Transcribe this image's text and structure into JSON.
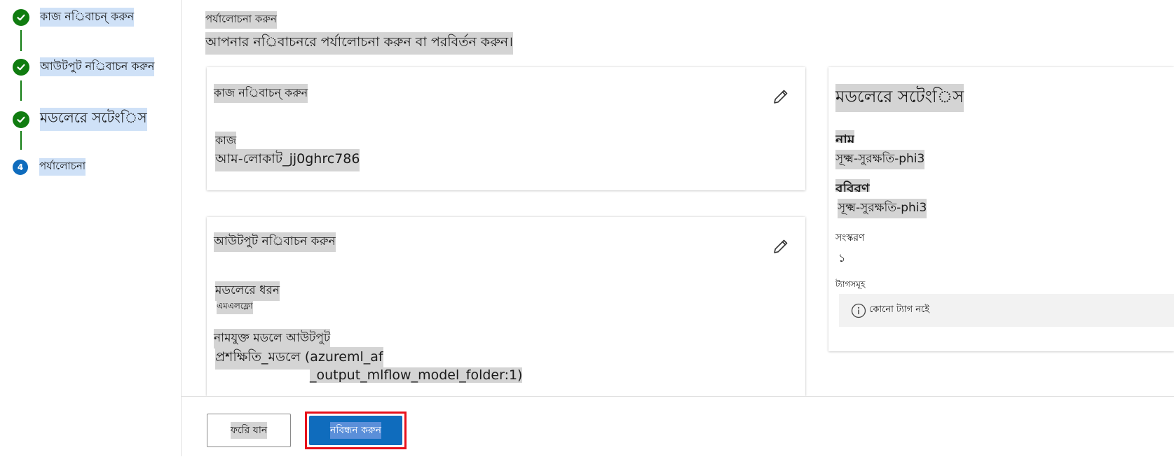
{
  "steps": [
    {
      "label": "কাজ নর্িবাচন্ করুন",
      "state": "done"
    },
    {
      "label": "আউটপুট নর্িবাচন করুন",
      "state": "done"
    },
    {
      "label": "মডলেরে সটেংিস",
      "state": "done"
    },
    {
      "label": "পর্যালোচনা",
      "state": "current",
      "number": "4"
    }
  ],
  "review": {
    "title": "পর্যালোচনা করুন",
    "subtitle": "আপনার নর্িবাচনরে পর্যালোচনা করুন বা পরবির্তন করুন।"
  },
  "task_card": {
    "title": "কাজ নর্িবাচন্ করুন",
    "field_label": "কাজ",
    "field_value": "আম-লোকাট_jj0ghrc786"
  },
  "output_card": {
    "title": "আউটপুট নর্িবাচন করুন",
    "model_type_label": "মডলেরে ধরন",
    "model_type_value": "এমএলফ্লো",
    "named_output_label": "নামযুক্ত মডলে আউটপুট",
    "named_output_value_line1": "প্রশক্ষিতি_মডলে (azureml_af",
    "named_output_value_line2": "_output_mlflow_model_folder:1)"
  },
  "settings_card": {
    "title": "মডলেরে সটেংিস",
    "name_label": "নাম",
    "name_value": "সূক্ষ্ম-সুরক্ষতি-phi3",
    "description_label": "ববিরণ",
    "description_value": "সূক্ষ্ম-সুরক্ষতি-phi3",
    "version_label": "সংস্করণ",
    "version_value": "১",
    "tags_label": "ট্যাগসমূহ",
    "tags_empty": "কোনো ট্যাগ নইে"
  },
  "footer": {
    "back_label": "ফরিে যান",
    "register_label": "নবিন্ধন করুন"
  },
  "colors": {
    "done_green": "#107c10",
    "current_blue": "#0f6cbd",
    "primary_button": "#0f6cbd",
    "highlight_border": "#e8101a"
  },
  "icons": {
    "check": "checkmark-icon",
    "edit": "pencil-icon",
    "info": "info-icon"
  }
}
